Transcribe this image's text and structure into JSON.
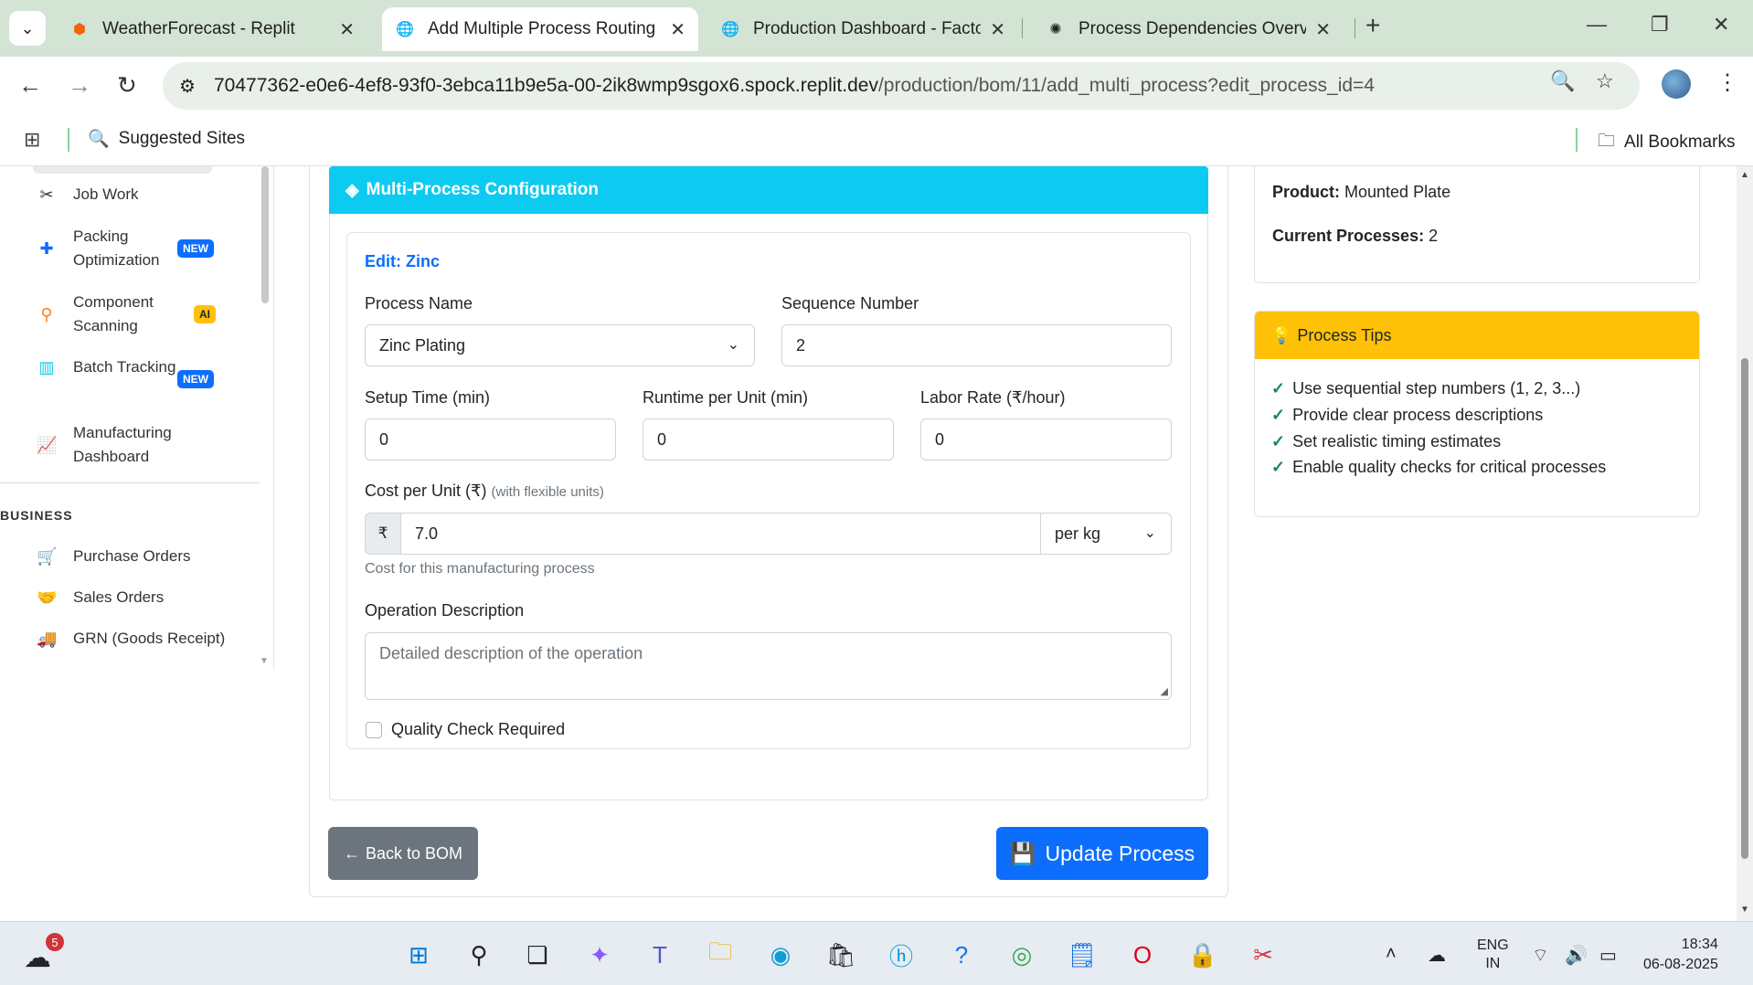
{
  "browser": {
    "tabs": [
      {
        "title": "WeatherForecast - Replit",
        "icon": "replit-icon",
        "active": false
      },
      {
        "title": "Add Multiple Process Routing -",
        "icon": "globe-icon",
        "active": true
      },
      {
        "title": "Production Dashboard - Factory",
        "icon": "globe-icon",
        "active": false
      },
      {
        "title": "Process Dependencies Overview",
        "icon": "openai-icon",
        "active": false
      }
    ],
    "url_host": "70477362-e0e6-4ef8-93f0-3ebca11b9e5a-00-2ik8wmp9sgox6.spock.replit.dev",
    "url_path": "/production/bom/11/add_multi_process?edit_process_id=4",
    "bookmarks": {
      "suggested": "Suggested Sites",
      "all": "All Bookmarks"
    }
  },
  "sidebar": {
    "items": [
      {
        "label": "Job Work",
        "icon": "tools-icon"
      },
      {
        "label": "Packing Optimization",
        "icon": "puzzle-icon",
        "badge": "NEW"
      },
      {
        "label": "Component Scanning",
        "icon": "search-icon",
        "badge": "AI"
      },
      {
        "label": "Batch Tracking",
        "icon": "barcode-icon",
        "badge": "NEW"
      },
      {
        "label": "Manufacturing Dashboard",
        "icon": "chart-line-icon"
      }
    ],
    "section": "BUSINESS",
    "business_items": [
      {
        "label": "Purchase Orders",
        "icon": "cart-icon"
      },
      {
        "label": "Sales Orders",
        "icon": "handshake-icon"
      },
      {
        "label": "GRN (Goods Receipt)",
        "icon": "truck-icon"
      }
    ]
  },
  "form": {
    "header": "Multi-Process Configuration",
    "edit_title": "Edit: Zinc",
    "process_name_label": "Process Name",
    "process_name_value": "Zinc Plating",
    "sequence_label": "Sequence Number",
    "sequence_value": "2",
    "setup_label": "Setup Time (min)",
    "setup_value": "0",
    "runtime_label": "Runtime per Unit (min)",
    "runtime_value": "0",
    "labor_label": "Labor Rate (₹/hour)",
    "labor_value": "0",
    "cost_label": "Cost per Unit (₹)",
    "cost_hint": "(with flexible units)",
    "currency_symbol": "₹",
    "cost_value": "7.0",
    "cost_unit": "per kg",
    "cost_help": "Cost for this manufacturing process",
    "description_label": "Operation Description",
    "description_placeholder": "Detailed description of the operation",
    "quality_label": "Quality Check Required",
    "back_button": "Back to BOM",
    "update_button": "Update Process"
  },
  "info": {
    "product_label": "Product:",
    "product_value": "Mounted Plate",
    "processes_label": "Current Processes:",
    "processes_value": "2"
  },
  "tips": {
    "header": "Process Tips",
    "items": [
      "Use sequential step numbers (1, 2, 3...)",
      "Provide clear process descriptions",
      "Set realistic timing estimates",
      "Enable quality checks for critical processes"
    ]
  },
  "taskbar": {
    "weather_badge": "5",
    "lang_1": "ENG",
    "lang_2": "IN",
    "time": "18:34",
    "date": "06-08-2025"
  }
}
